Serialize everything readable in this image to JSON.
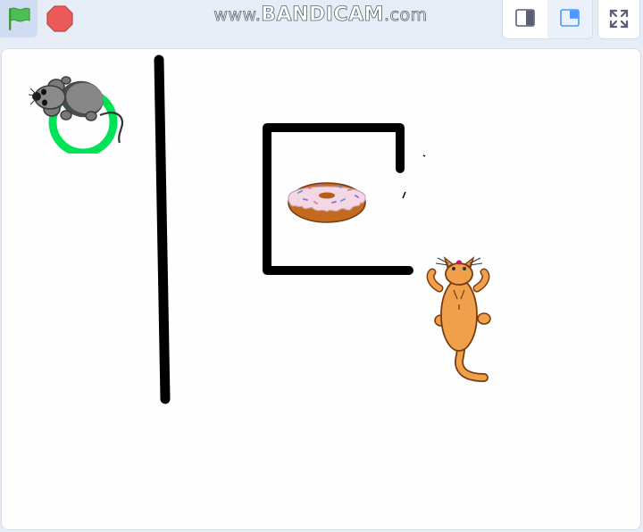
{
  "toolbar": {
    "green_flag": {
      "icon": "green-flag-icon",
      "color": "#4cbf56"
    },
    "stop": {
      "icon": "stop-sign-icon",
      "color": "#ec5959"
    },
    "layout_small": {
      "icon": "small-stage-icon"
    },
    "layout_normal": {
      "icon": "normal-stage-icon",
      "active": true
    },
    "fullscreen": {
      "icon": "fullscreen-icon"
    },
    "accent": "#4c97ff"
  },
  "watermark": {
    "prefix": "www.",
    "brand": "BANDICAM",
    "suffix": ".com"
  },
  "stage": {
    "sprites": [
      {
        "name": "mouse",
        "icon": "mouse-sprite"
      },
      {
        "name": "donut",
        "icon": "donut-sprite"
      },
      {
        "name": "cat",
        "icon": "cat-sprite"
      }
    ],
    "target_ring_color": "#00e356",
    "wall_color": "#000000"
  }
}
